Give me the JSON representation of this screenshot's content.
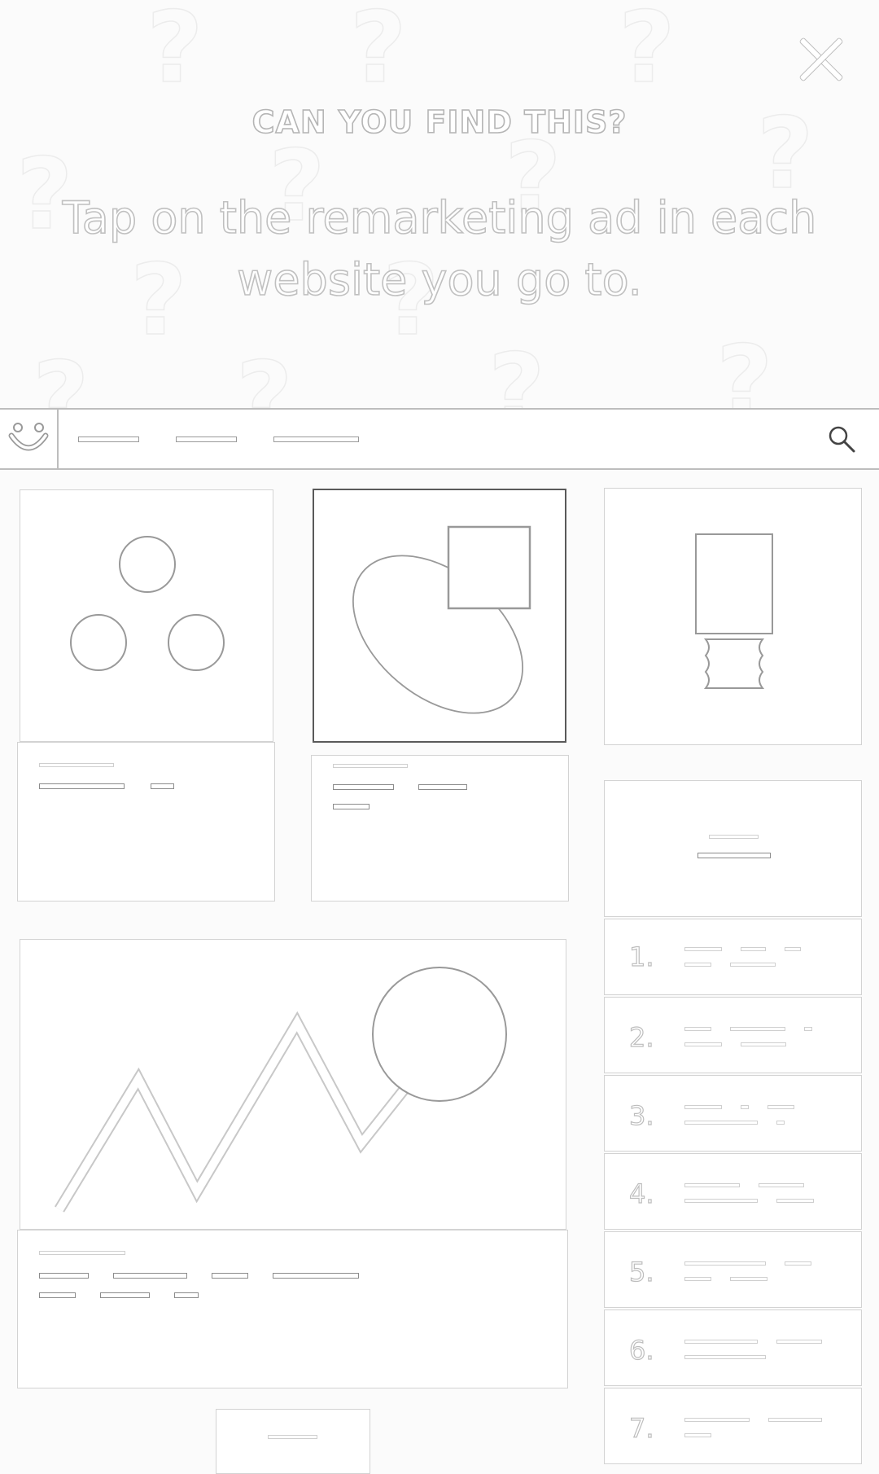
{
  "header": {
    "heading": "CAN YOU FIND THIS?",
    "instruction": "Tap on the remarketing ad in each website you go to."
  },
  "icons": {
    "close": "close-icon",
    "logo": "smiley-logo-icon",
    "search": "search-icon",
    "decor": "question-mark-icon"
  },
  "list": {
    "numbers": [
      "1.",
      "2.",
      "3.",
      "4.",
      "5.",
      "6.",
      "7."
    ]
  }
}
